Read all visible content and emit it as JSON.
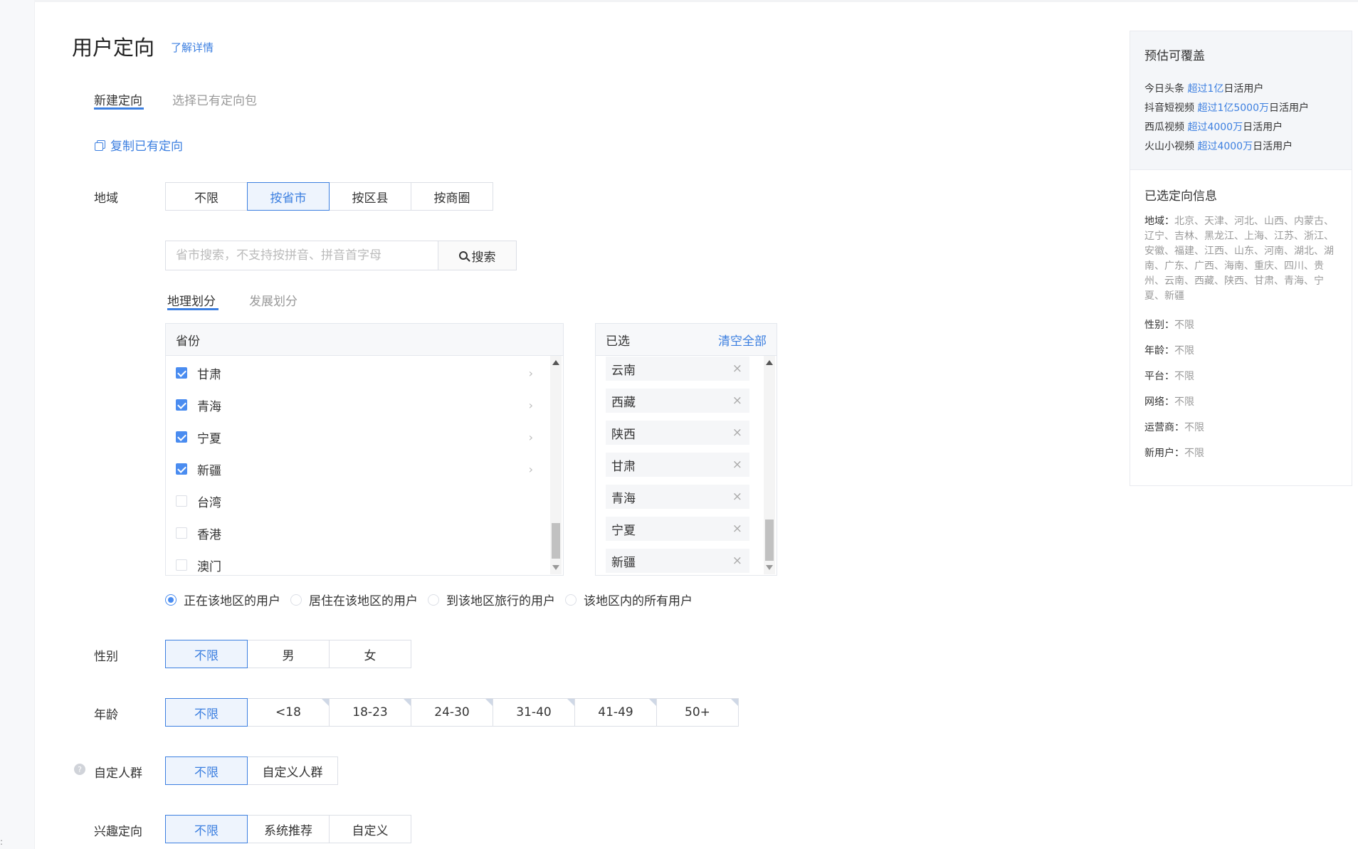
{
  "page": {
    "title": "用户定向",
    "learn_more": "了解详情"
  },
  "nav": {
    "marker": ":"
  },
  "tabs": [
    {
      "label": "新建定向",
      "active": true
    },
    {
      "label": "选择已有定向包",
      "active": false
    }
  ],
  "copy_existing": "复制已有定向",
  "region": {
    "label": "地域",
    "options": [
      "不限",
      "按省市",
      "按区县",
      "按商圈"
    ],
    "selected": "按省市",
    "search": {
      "placeholder": "省市搜索，不支持按拼音、拼音首字母",
      "button": "搜索"
    },
    "subtabs": [
      {
        "label": "地理划分",
        "active": true
      },
      {
        "label": "发展划分",
        "active": false
      }
    ],
    "provinces_header": "省份",
    "provinces": [
      {
        "name": "甘肃",
        "checked": true,
        "has_children": true
      },
      {
        "name": "青海",
        "checked": true,
        "has_children": true
      },
      {
        "name": "宁夏",
        "checked": true,
        "has_children": true
      },
      {
        "name": "新疆",
        "checked": true,
        "has_children": true
      },
      {
        "name": "台湾",
        "checked": false,
        "has_children": false
      },
      {
        "name": "香港",
        "checked": false,
        "has_children": false
      },
      {
        "name": "澳门",
        "checked": false,
        "has_children": false
      }
    ],
    "selected_header": "已选",
    "clear_all": "清空全部",
    "selected_items": [
      "云南",
      "西藏",
      "陕西",
      "甘肃",
      "青海",
      "宁夏",
      "新疆"
    ],
    "user_types": [
      {
        "label": "正在该地区的用户",
        "checked": true
      },
      {
        "label": "居住在该地区的用户",
        "checked": false
      },
      {
        "label": "到该地区旅行的用户",
        "checked": false
      },
      {
        "label": "该地区内的所有用户",
        "checked": false
      }
    ]
  },
  "gender": {
    "label": "性别",
    "options": [
      "不限",
      "男",
      "女"
    ],
    "selected": "不限"
  },
  "age": {
    "label": "年龄",
    "options": [
      "不限",
      "<18",
      "18-23",
      "24-30",
      "31-40",
      "41-49",
      "50+"
    ],
    "selected": "不限"
  },
  "custom_audience": {
    "label": "自定人群",
    "options": [
      "不限",
      "自定义人群"
    ],
    "selected": "不限",
    "help_icon": "?"
  },
  "interest": {
    "label": "兴趣定向",
    "options": [
      "不限",
      "系统推荐",
      "自定义"
    ],
    "selected": "不限"
  },
  "sidebar": {
    "coverage_title": "预估可覆盖",
    "coverage": [
      {
        "platform": "今日头条",
        "value": "超过1亿",
        "suffix": "日活用户"
      },
      {
        "platform": "抖音短视频",
        "value": "超过1亿5000万",
        "suffix": "日活用户"
      },
      {
        "platform": "西瓜视频",
        "value": "超过4000万",
        "suffix": "日活用户"
      },
      {
        "platform": "火山小视频",
        "value": "超过4000万",
        "suffix": "日活用户"
      }
    ],
    "selected_title": "已选定向信息",
    "region_key": "地域：",
    "region_value": "北京、天津、河北、山西、内蒙古、辽宁、吉林、黑龙江、上海、江苏、浙江、安徽、福建、江西、山东、河南、湖北、湖南、广东、广西、海南、重庆、四川、贵州、云南、西藏、陕西、甘肃、青海、宁夏、新疆",
    "items": [
      {
        "key": "性别：",
        "value": "不限"
      },
      {
        "key": "年龄：",
        "value": "不限"
      },
      {
        "key": "平台：",
        "value": "不限"
      },
      {
        "key": "网络：",
        "value": "不限"
      },
      {
        "key": "运营商：",
        "value": "不限"
      },
      {
        "key": "新用户：",
        "value": "不限"
      }
    ]
  },
  "colors": {
    "accent": "#3c7fe0",
    "checkbox": "#4a8cf0",
    "active_bg": "#eef4fd",
    "border": "#dcdfe6"
  }
}
